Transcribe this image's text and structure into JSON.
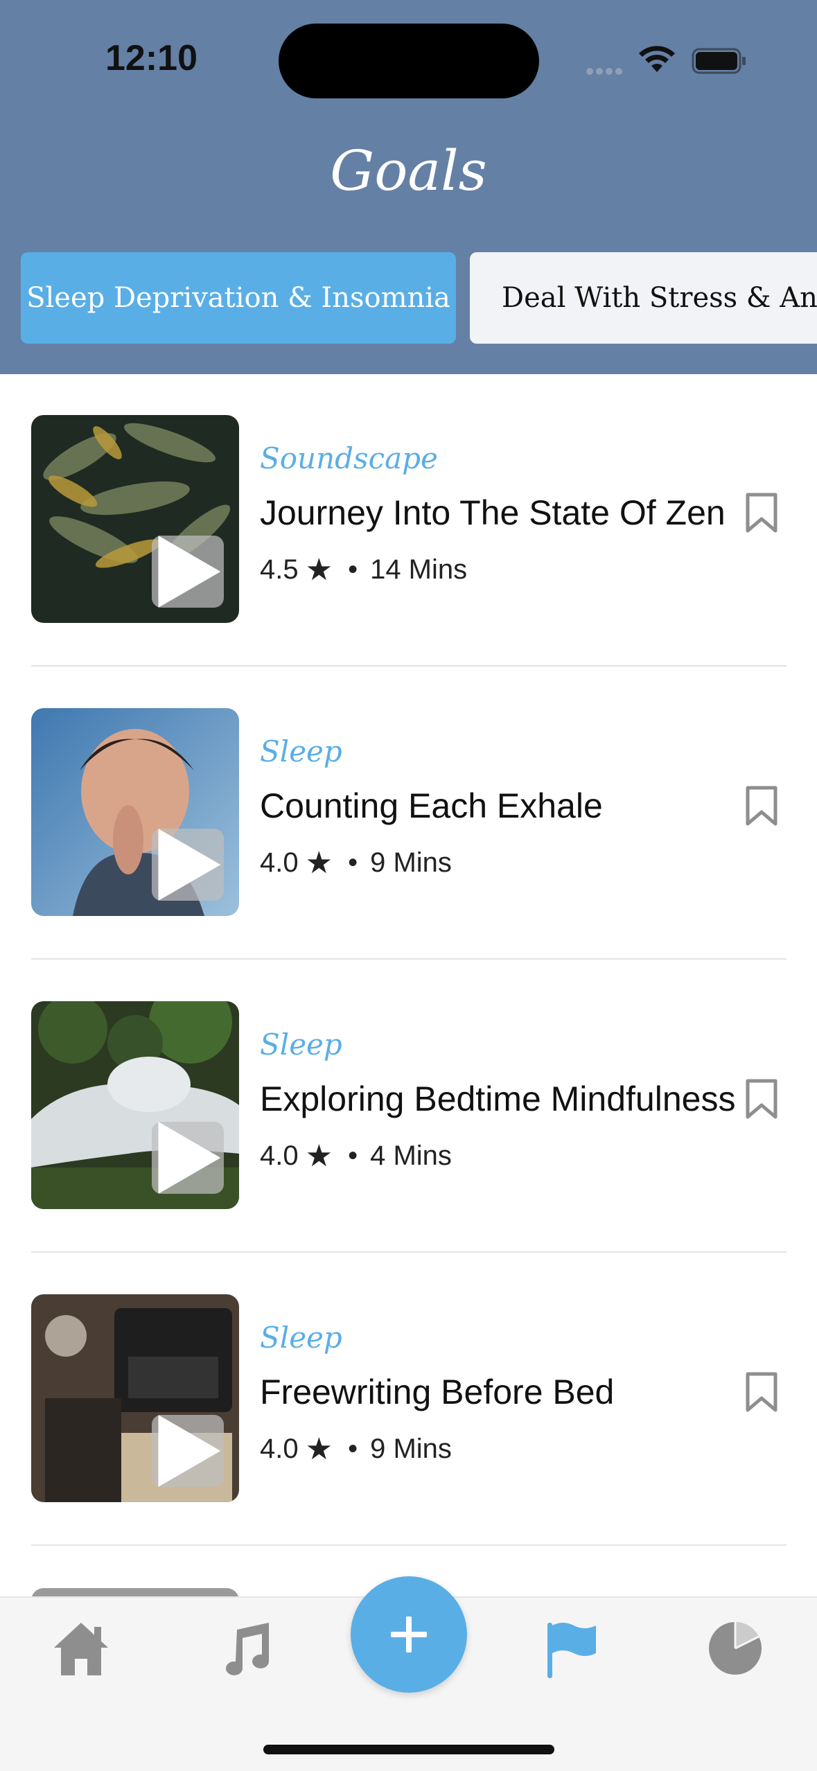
{
  "status_bar": {
    "time": "12:10"
  },
  "header": {
    "title": "Goals"
  },
  "tabs": [
    {
      "label": "Sleep Deprivation & Insomnia",
      "active": true
    },
    {
      "label": "Deal With Stress & Anxiety",
      "active": false
    }
  ],
  "items": [
    {
      "category": "Soundscape",
      "title": "Journey Into The State Of Zen",
      "rating": "4.5",
      "duration": "14 Mins",
      "image": "fern-leaves"
    },
    {
      "category": "Sleep",
      "title": "Counting Each Exhale",
      "rating": "4.0",
      "duration": "9 Mins",
      "image": "woman-breathing"
    },
    {
      "category": "Sleep",
      "title": "Exploring Bedtime Mindfulness",
      "rating": "4.0",
      "duration": "4 Mins",
      "image": "reclining-buddha"
    },
    {
      "category": "Sleep",
      "title": "Freewriting Before Bed",
      "rating": "4.0",
      "duration": "9 Mins",
      "image": "typewriter-desk"
    }
  ],
  "nav": {
    "items": [
      "home-icon",
      "music-icon",
      "add-icon",
      "flag-icon",
      "pie-chart-icon"
    ],
    "active": "flag-icon",
    "colors": {
      "accent": "#5AAEE6",
      "inactive": "#8E8E8E",
      "header": "#6580A5"
    }
  }
}
